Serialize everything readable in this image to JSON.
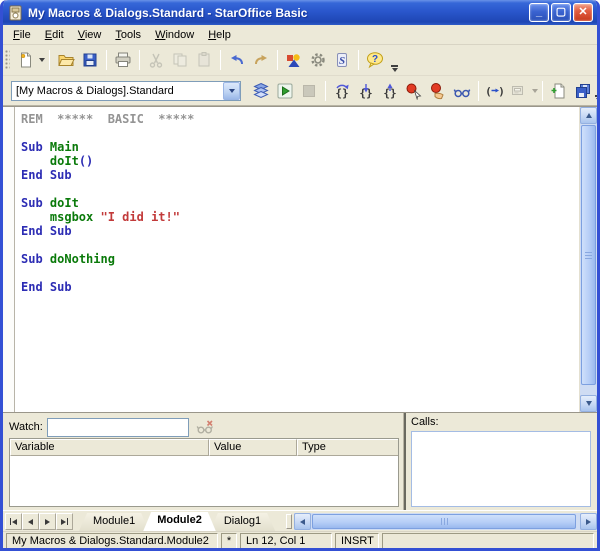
{
  "window": {
    "title": "My Macros & Dialogs.Standard - StarOffice Basic"
  },
  "titlebar": {
    "buttons": [
      {
        "name": "minimize-button"
      },
      {
        "name": "maximize-button"
      },
      {
        "name": "close-button"
      }
    ]
  },
  "menus": [
    "File",
    "Edit",
    "View",
    "Tools",
    "Window",
    "Help"
  ],
  "toolbar_main": {
    "items": [
      {
        "name": "new-document",
        "dropdown": true
      },
      {
        "separator": true
      },
      {
        "name": "open"
      },
      {
        "name": "save"
      },
      {
        "separator": true
      },
      {
        "name": "print"
      },
      {
        "separator": true
      },
      {
        "name": "cut",
        "disabled": true
      },
      {
        "name": "copy",
        "disabled": true
      },
      {
        "name": "paste",
        "disabled": true
      },
      {
        "separator": true
      },
      {
        "name": "undo"
      },
      {
        "name": "redo"
      },
      {
        "separator": true
      },
      {
        "name": "gallery"
      },
      {
        "name": "settings"
      },
      {
        "name": "macros"
      },
      {
        "separator": true
      },
      {
        "name": "help"
      }
    ]
  },
  "toolbar_macro": {
    "library_value": "[My Macros & Dialogs].Standard",
    "items": [
      {
        "name": "compile"
      },
      {
        "name": "run"
      },
      {
        "name": "stop",
        "disabled": true
      },
      {
        "separator": true
      },
      {
        "name": "step-over"
      },
      {
        "name": "step-into"
      },
      {
        "name": "step-out"
      },
      {
        "name": "breakpoint"
      },
      {
        "name": "manage-breakpoints"
      },
      {
        "name": "enable-watch"
      },
      {
        "separator": true
      },
      {
        "name": "find-parentheses"
      },
      {
        "name": "insert-controls",
        "disabled": true,
        "dropdown": true
      },
      {
        "separator": true
      },
      {
        "name": "insert-source-text"
      },
      {
        "name": "save-source-as"
      }
    ]
  },
  "editor": {
    "lines": [
      [
        {
          "c": "com",
          "t": "REM  *****  BASIC  *****"
        }
      ],
      [],
      [
        {
          "c": "kw",
          "t": "Sub"
        },
        {
          "c": "pl",
          "t": " "
        },
        {
          "c": "id",
          "t": "Main"
        }
      ],
      [
        {
          "c": "pl",
          "t": "    "
        },
        {
          "c": "id",
          "t": "doIt"
        },
        {
          "c": "kw",
          "t": "()"
        }
      ],
      [
        {
          "c": "kw",
          "t": "End Sub"
        }
      ],
      [],
      [
        {
          "c": "kw",
          "t": "Sub"
        },
        {
          "c": "pl",
          "t": " "
        },
        {
          "c": "id",
          "t": "doIt"
        }
      ],
      [
        {
          "c": "pl",
          "t": "    "
        },
        {
          "c": "id",
          "t": "msgbox"
        },
        {
          "c": "pl",
          "t": " "
        },
        {
          "c": "str",
          "t": "\"I did it!\""
        }
      ],
      [
        {
          "c": "kw",
          "t": "End Sub"
        }
      ],
      [],
      [
        {
          "c": "kw",
          "t": "Sub"
        },
        {
          "c": "pl",
          "t": " "
        },
        {
          "c": "id",
          "t": "doNothing"
        }
      ],
      [],
      [
        {
          "c": "kw",
          "t": "End Sub"
        }
      ]
    ]
  },
  "watch": {
    "label": "Watch:",
    "input_value": "",
    "remove_button": {
      "name": "remove-watch",
      "disabled": true
    },
    "columns": [
      "Variable",
      "Value",
      "Type"
    ]
  },
  "calls": {
    "label": "Calls:"
  },
  "tabs": {
    "items": [
      {
        "label": "Module1",
        "active": false
      },
      {
        "label": "Module2",
        "active": true
      },
      {
        "label": "Dialog1",
        "active": false
      }
    ]
  },
  "statusbar": {
    "document": "My Macros & Dialogs.Standard.Module2",
    "modified": "*",
    "position": "Ln 12, Col 1",
    "insert_mode": "INSRT"
  },
  "colors": {
    "titlebar_blue": "#2a57cc",
    "window_border": "#3450d4",
    "chrome_beige": "#ece9d8",
    "keyword_blue": "#2d2db4",
    "identifier_green": "#0a7a0a",
    "string_red": "#c23a3a",
    "comment_gray": "#949494",
    "scrollbar_blue": "#b4ccf6"
  }
}
